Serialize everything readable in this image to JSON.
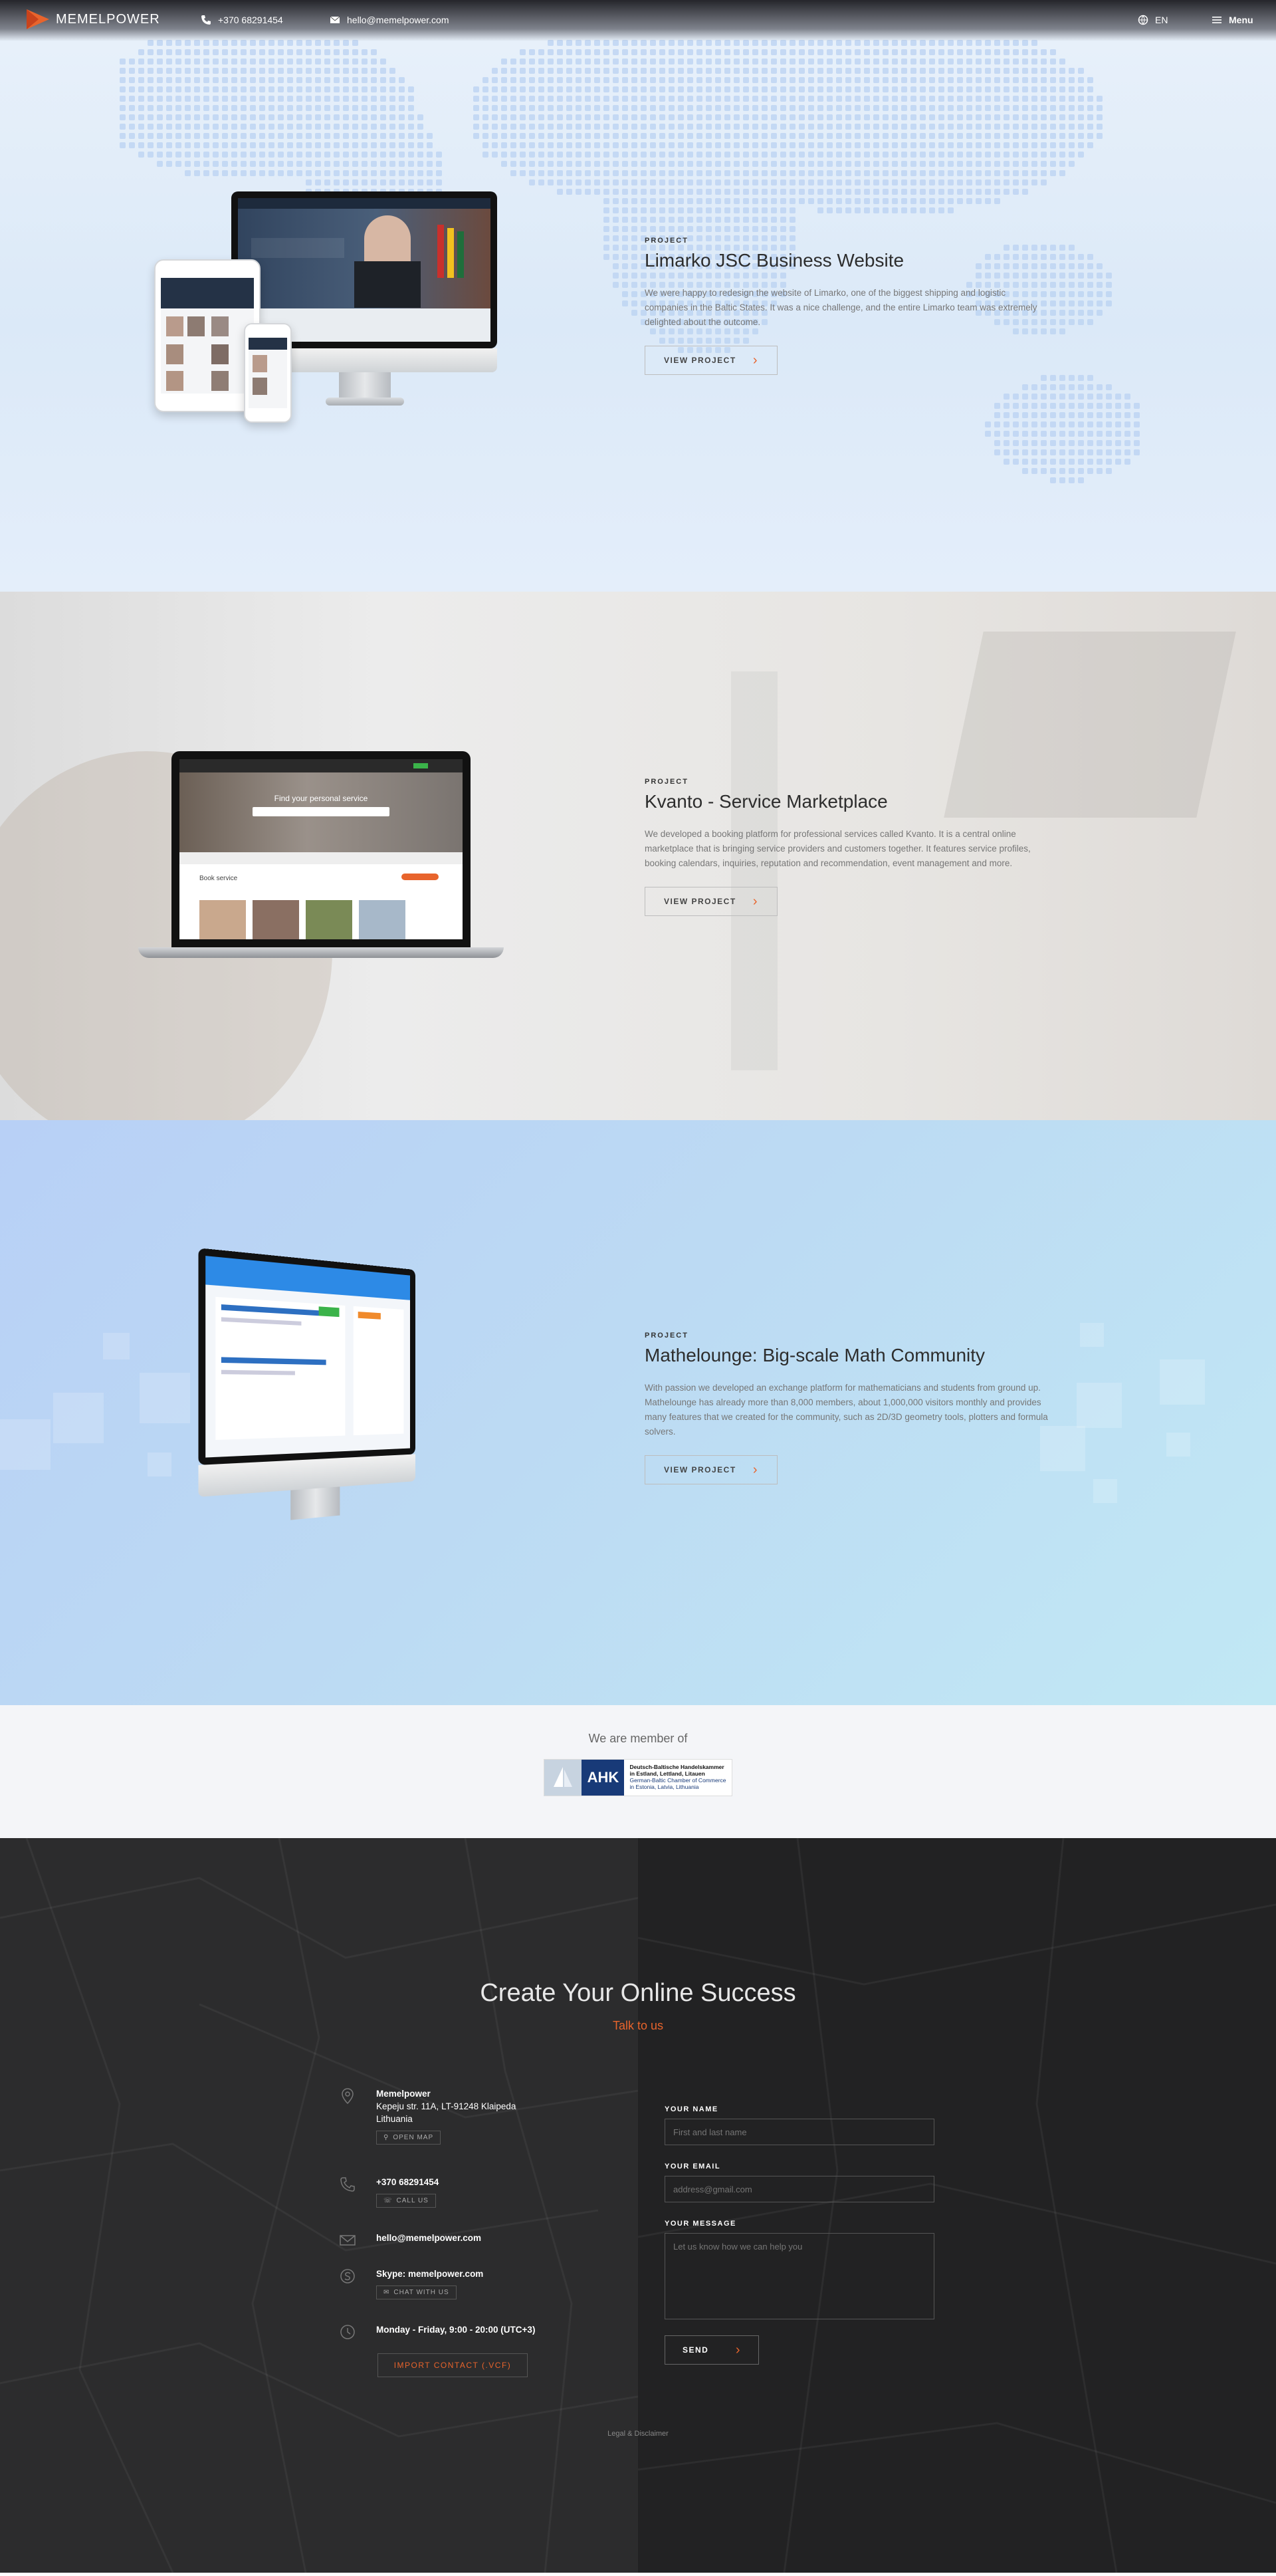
{
  "header": {
    "logo_text": "MEMELPOWER",
    "phone": "+370 68291454",
    "email": "hello@memelpower.com",
    "language": "EN",
    "menu_label": "Menu"
  },
  "projects": [
    {
      "label": "PROJECT",
      "title": "Limarko JSC Business Website",
      "description": "We were happy to redesign the website of Limarko, one of the biggest shipping and logistic companies in the Baltic States. It was a nice challenge, and the entire Limarko team was extremely delighted about the outcome.",
      "button": "VIEW PROJECT"
    },
    {
      "label": "PROJECT",
      "title": "Kvanto - Service Marketplace",
      "description": "We developed a booking platform for professional services called Kvanto. It is a central online marketplace that is bringing service providers and customers together. It features service profiles, booking calendars, inquiries, reputation and recommendation, event management and more.",
      "button": "VIEW PROJECT"
    },
    {
      "label": "PROJECT",
      "title": "Mathelounge: Big-scale Math Community",
      "description": "With passion we developed an exchange platform for mathematicians and students from ground up. Mathelounge has already more than 8,000 members, about 1,000,000 visitors monthly and provides many features that we created for the community, such as 2D/3D geometry tools, plotters and formula solvers.",
      "button": "VIEW PROJECT"
    }
  ],
  "device_screens": {
    "kvanto_hero": "Find your personal service",
    "kvanto_section": "Book service"
  },
  "member": {
    "title": "We are member of",
    "ahk_short": "AHK",
    "ahk_line1": "Deutsch-Baltische Handelskammer",
    "ahk_line2": "in Estland, Lettland, Litauen",
    "ahk_line3": "German-Baltic Chamber of Commerce",
    "ahk_line4": "in Estonia, Latvia, Lithuania"
  },
  "contact": {
    "title": "Create Your Online Success",
    "subtitle": "Talk to us",
    "company": "Memelpower",
    "address_line1": "Kepeju str. 11A, LT-91248 Klaipeda",
    "address_line2": "Lithuania",
    "open_map": "OPEN MAP",
    "phone": "+370 68291454",
    "call_us": "CALL US",
    "email": "hello@memelpower.com",
    "skype": "Skype: memelpower.com",
    "chat_with_us": "CHAT WITH US",
    "hours": "Monday - Friday, 9:00 - 20:00 (UTC+3)",
    "import_contact": "IMPORT CONTACT (.VCF)",
    "form": {
      "name_label": "YOUR NAME",
      "name_placeholder": "First and last name",
      "email_label": "YOUR EMAIL",
      "email_placeholder": "address@gmail.com",
      "message_label": "YOUR MESSAGE",
      "message_placeholder": "Let us know how we can help you",
      "send": "SEND"
    },
    "legal": "Legal & Disclaimer"
  },
  "colors": {
    "accent": "#e8642c",
    "dark": "#232323"
  }
}
